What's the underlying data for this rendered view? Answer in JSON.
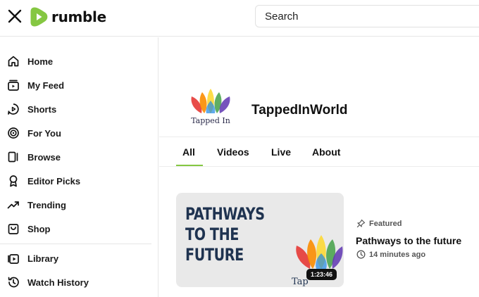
{
  "header": {
    "logo_text": "rumble",
    "search_placeholder": "Search",
    "brand_color": "#85c742"
  },
  "sidebar": {
    "items": [
      {
        "label": "Home",
        "icon": "home-icon"
      },
      {
        "label": "My Feed",
        "icon": "feed-icon"
      },
      {
        "label": "Shorts",
        "icon": "shorts-icon"
      },
      {
        "label": "For You",
        "icon": "target-icon"
      },
      {
        "label": "Browse",
        "icon": "browse-icon"
      },
      {
        "label": "Editor Picks",
        "icon": "ribbon-icon"
      },
      {
        "label": "Trending",
        "icon": "trending-icon"
      },
      {
        "label": "Shop",
        "icon": "shopping-bag-icon"
      },
      {
        "label": "Library",
        "icon": "library-icon"
      },
      {
        "label": "Watch History",
        "icon": "history-icon"
      }
    ]
  },
  "channel": {
    "name": "TappedInWorld",
    "logo_caption": "Tapped In",
    "tabs": [
      "All",
      "Videos",
      "Live",
      "About"
    ],
    "active_tab": "All"
  },
  "video": {
    "thumbnail_text": "PATHWAYS TO THE FUTURE",
    "thumbnail_logo_caption": "Tap",
    "duration": "1:23:46",
    "badge": "Featured",
    "title": "Pathways to the future",
    "time_ago": "14 minutes ago"
  }
}
